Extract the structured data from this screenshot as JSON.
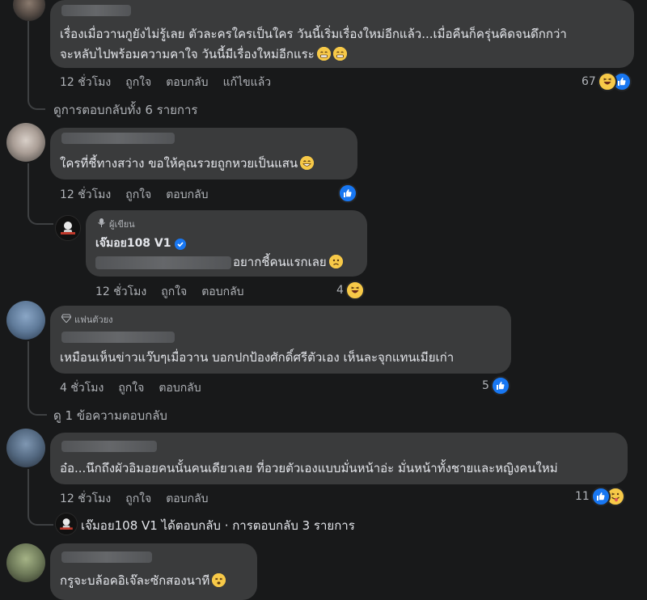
{
  "comments": [
    {
      "text_line1": "เรื่องเมื่อวานกูยังไม่รู้เลย ตัวละครใครเป็นใคร วันนี้เริ่มเรื่องใหม่อีกแล้ว...เมื่อคืนก็ครุ่นคิดจนดึกกว่า",
      "text_line2": "จะหลับไปพร้อมความคาใจ วันนี้มีเรื่องใหม่อีกแระ",
      "time": "12 ชั่วโมง",
      "like": "ถูกใจ",
      "reply": "ตอบกลับ",
      "edited": "แก้ไขแล้ว",
      "reaction_count": "67",
      "view_replies": "ดูการตอบกลับทั้ง 6 รายการ"
    },
    {
      "text": "ใครที่ชี้ทางสว่าง ขอให้คุณรวยถูกหวยเป็นแสน",
      "time": "12 ชั่วโมง",
      "like": "ถูกใจ",
      "reply": "ตอบกลับ",
      "author_reply": {
        "badge": "ผู้เขียน",
        "name": "เจ๊มอย108 V1",
        "text": "อยากชี้คนแรกเลย",
        "time": "12 ชั่วโมง",
        "like": "ถูกใจ",
        "reply": "ตอบกลับ",
        "reaction_count": "4"
      }
    },
    {
      "badge": "แฟนตัวยง",
      "text": "เหมือนเห็นข่าวแว๊บๆเมื่อวาน บอกปกป้องศักดิ์ศรีตัวเอง เห็นละจุกแทนเมียเก่า",
      "time": "4 ชั่วโมง",
      "like": "ถูกใจ",
      "reply": "ตอบกลับ",
      "reaction_count": "5",
      "view_replies": "ดู 1 ข้อความตอบกลับ"
    },
    {
      "text": "อ๋อ...นึกถึงผัวอิมอยคนนั้นคนเดียวเลย ที่อวยตัวเองแบบมั่นหน้าอ่ะ มั่นหน้าทั้งชายและหญิงคนใหม่",
      "time": "12 ชั่วโมง",
      "like": "ถูกใจ",
      "reply": "ตอบกลับ",
      "reaction_count": "11",
      "reply_summary": "เจ๊มอย108 V1 ได้ตอบกลับ · การตอบกลับ 3 รายการ"
    },
    {
      "text": "กรูจะบล้อคอิเจ๊ละซักสองนาที"
    }
  ],
  "colors": {
    "background": "#18191a",
    "bubble": "#3a3b3c",
    "like_blue": "#1877f2",
    "secondary_text": "#b0b3b8"
  }
}
